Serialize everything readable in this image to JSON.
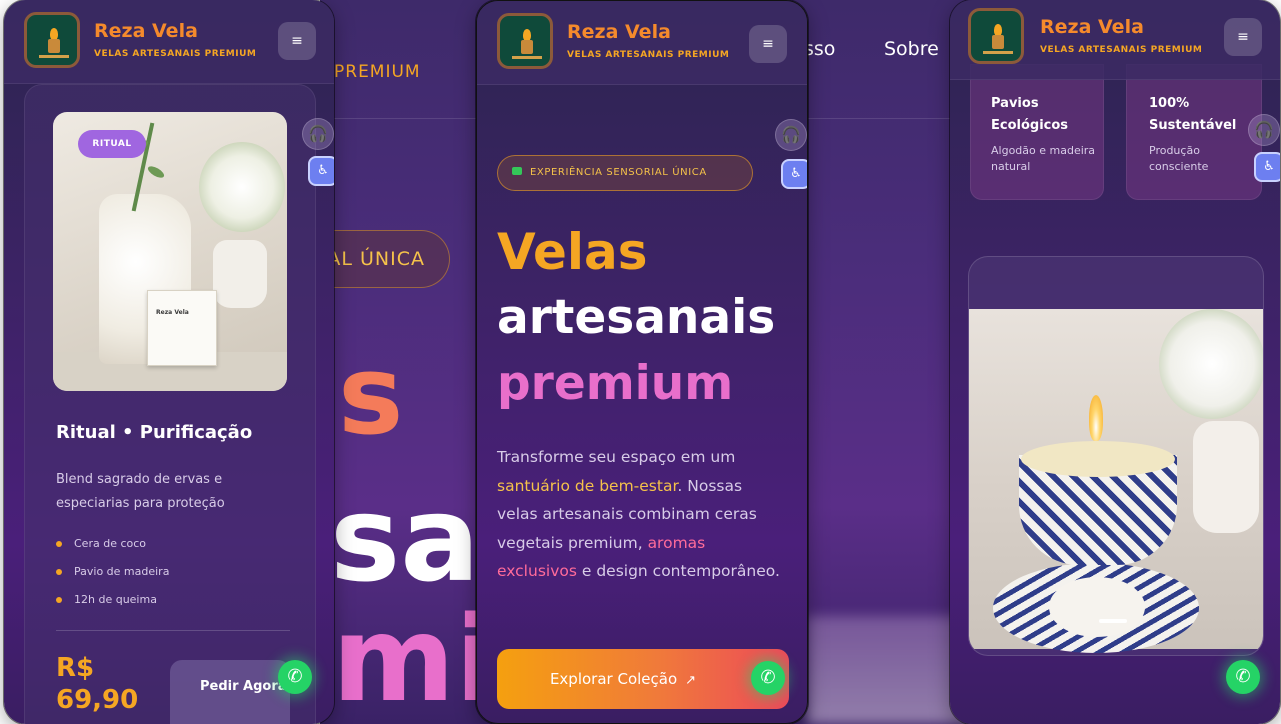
{
  "brand": {
    "name": "Reza Vela",
    "tagline": "VELAS ARTESANAIS PREMIUM",
    "menu_icon": "≡"
  },
  "background_desktop": {
    "nav": [
      "sso",
      "Sobre"
    ],
    "tagline_fragment": "PREMIUM",
    "pill_fragment": "AL ÚNICA",
    "hero_fragments": [
      "s",
      "sa",
      "miu"
    ]
  },
  "left_panel": {
    "badge": "RITUAL",
    "product": {
      "title": "Ritual • Purificação",
      "description": "Blend sagrado de ervas e especiarias para proteção",
      "features": [
        "Cera de coco",
        "Pavio de madeira",
        "12h de queima"
      ],
      "price": "R$ 69,90",
      "order_button": "Pedir Agora"
    }
  },
  "center_panel": {
    "experience_pill": "EXPERIÊNCIA SENSORIAL ÚNICA",
    "hero": {
      "line1": "Velas",
      "line2": "artesanais",
      "line3": "premium"
    },
    "body": {
      "part1": "Transforme seu espaço em um ",
      "highlight1": "santuário de bem-estar",
      "part2": ". Nossas velas artesanais combinam ceras vegetais premium, ",
      "highlight2": "aromas exclusivos",
      "part3": " e design contemporâneo."
    },
    "cta": "Explorar Coleção",
    "cta_arrow": "↗"
  },
  "right_panel": {
    "features": [
      {
        "title": "Pavios Ecológicos",
        "subtitle": "Algodão e madeira natural"
      },
      {
        "title": "100% Sustentável",
        "subtitle": "Produção consciente"
      }
    ]
  },
  "icons": {
    "headphones": "🎧",
    "accessibility": "♿",
    "whatsapp": "✆"
  },
  "colors": {
    "accent_orange": "#f5a623",
    "accent_pink": "#e86fcb",
    "whatsapp_green": "#25d366",
    "badge_purple": "#a066e0",
    "bg_purple": "#3d2366"
  }
}
